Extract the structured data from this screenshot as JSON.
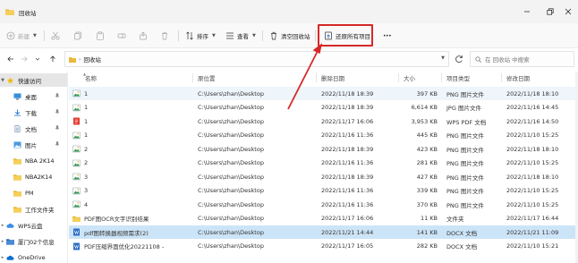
{
  "window": {
    "title": "回收站"
  },
  "toolbar": {
    "new_label": "新建",
    "sort_label": "排序",
    "view_label": "查看",
    "empty_label": "清空回收站",
    "restore_all_label": "还原所有项目",
    "more_label": "•••"
  },
  "address": {
    "breadcrumb": "回收站",
    "search_placeholder": "在 回收站 中搜索"
  },
  "sidebar": {
    "items": [
      {
        "label": "快速访问",
        "icon": "star-icon"
      },
      {
        "label": "桌面",
        "icon": "desktop-icon"
      },
      {
        "label": "下载",
        "icon": "download-icon"
      },
      {
        "label": "文档",
        "icon": "document-icon"
      },
      {
        "label": "图片",
        "icon": "picture-icon"
      },
      {
        "label": "NBA 2K14",
        "icon": "folder-icon"
      },
      {
        "label": "NBA2K14",
        "icon": "folder-icon"
      },
      {
        "label": "PM",
        "icon": "folder-icon"
      },
      {
        "label": "工作文件夹",
        "icon": "folder-icon"
      },
      {
        "label": "WPS云盘",
        "icon": "cloud-icon"
      },
      {
        "label": "厦门02个信息",
        "icon": "folder-icon"
      },
      {
        "label": "OneDrive",
        "icon": "onedrive-icon"
      }
    ]
  },
  "columns": {
    "name": "名称",
    "location": "原位置",
    "deleted": "删除日期",
    "size": "大小",
    "type": "项目类型",
    "modified": "修改日期"
  },
  "rows": [
    {
      "name": "1",
      "location": "C:\\Users\\zhan\\Desktop",
      "deleted": "2022/11/18 18:39",
      "size": "397 KB",
      "type": "PNG 图片文件",
      "modified": "2022/11/18 18:10",
      "icon": "image-file-icon"
    },
    {
      "name": "1",
      "location": "C:\\Users\\zhan\\Desktop",
      "deleted": "2022/11/18 18:39",
      "size": "6,614 KB",
      "type": "JPG 图片文件",
      "modified": "2022/11/16 14:45",
      "icon": "image-file-icon"
    },
    {
      "name": "1",
      "location": "C:\\Users\\zhan\\Desktop",
      "deleted": "2022/11/17 16:06",
      "size": "3,953 KB",
      "type": "WPS PDF 文档",
      "modified": "2022/11/16 14:50",
      "icon": "pdf-file-icon"
    },
    {
      "name": "1",
      "location": "C:\\Users\\zhan\\Desktop",
      "deleted": "2022/11/16 11:36",
      "size": "445 KB",
      "type": "PNG 图片文件",
      "modified": "2022/11/10 15:25",
      "icon": "image-file-icon"
    },
    {
      "name": "2",
      "location": "C:\\Users\\zhan\\Desktop",
      "deleted": "2022/11/18 18:39",
      "size": "423 KB",
      "type": "PNG 图片文件",
      "modified": "2022/11/18 18:10",
      "icon": "image-file-icon"
    },
    {
      "name": "2",
      "location": "C:\\Users\\zhan\\Desktop",
      "deleted": "2022/11/16 11:36",
      "size": "281 KB",
      "type": "PNG 图片文件",
      "modified": "2022/11/10 15:25",
      "icon": "image-file-icon"
    },
    {
      "name": "3",
      "location": "C:\\Users\\zhan\\Desktop",
      "deleted": "2022/11/18 18:39",
      "size": "427 KB",
      "type": "PNG 图片文件",
      "modified": "2022/11/18 18:10",
      "icon": "image-file-icon"
    },
    {
      "name": "3",
      "location": "C:\\Users\\zhan\\Desktop",
      "deleted": "2022/11/16 11:36",
      "size": "339 KB",
      "type": "PNG 图片文件",
      "modified": "2022/11/10 15:25",
      "icon": "image-file-icon"
    },
    {
      "name": "4",
      "location": "C:\\Users\\zhan\\Desktop",
      "deleted": "2022/11/16 11:36",
      "size": "370 KB",
      "type": "PNG 图片文件",
      "modified": "2022/11/10 15:25",
      "icon": "image-file-icon"
    },
    {
      "name": "PDF图OCR文字识别结果",
      "location": "C:\\Users\\zhan\\Desktop",
      "deleted": "2022/11/17 16:06",
      "size": "11 KB",
      "type": "文件夹",
      "modified": "2022/11/17 16:44",
      "icon": "folder-icon"
    },
    {
      "name": "pdf图转换器视频需求(2)",
      "location": "C:\\Users\\zhan\\Desktop",
      "deleted": "2022/11/21 14:44",
      "size": "141 KB",
      "type": "DOCX 文档",
      "modified": "2022/11/21 11:09",
      "icon": "word-file-icon"
    },
    {
      "name": "PDF压缩界面优化20221108 -",
      "location": "C:\\Users\\zhan\\Desktop",
      "deleted": "2022/11/17 16:05",
      "size": "282 KB",
      "type": "DOCX 文档",
      "modified": "2022/11/10 15:21",
      "icon": "word-file-icon"
    }
  ]
}
